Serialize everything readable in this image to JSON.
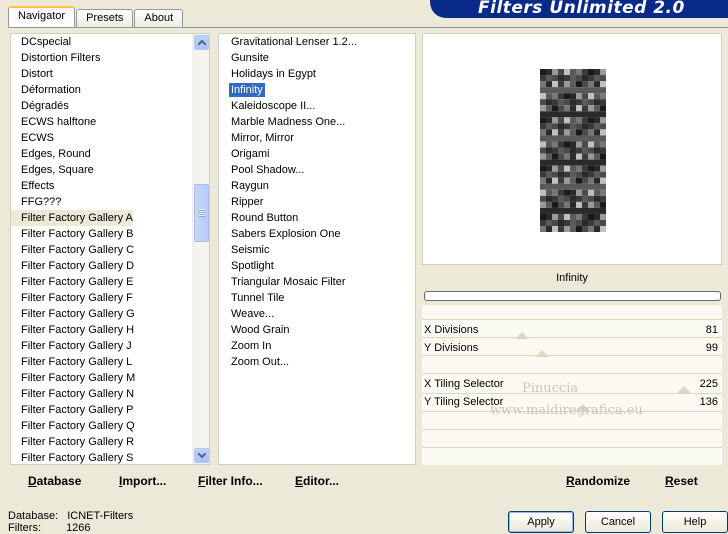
{
  "tabs": [
    "Navigator",
    "Presets",
    "About"
  ],
  "app_title": "Filters Unlimited 2.0",
  "categories": [
    "DCspecial",
    "Distortion Filters",
    "Distort",
    "Déformation",
    "Dégradés",
    "ECWS halftone",
    "ECWS",
    "Edges, Round",
    "Edges, Square",
    "Effects",
    "FFG???",
    "Filter Factory Gallery A",
    "Filter Factory Gallery B",
    "Filter Factory Gallery C",
    "Filter Factory Gallery D",
    "Filter Factory Gallery E",
    "Filter Factory Gallery F",
    "Filter Factory Gallery G",
    "Filter Factory Gallery H",
    "Filter Factory Gallery J",
    "Filter Factory Gallery L",
    "Filter Factory Gallery M",
    "Filter Factory Gallery N",
    "Filter Factory Gallery P",
    "Filter Factory Gallery Q",
    "Filter Factory Gallery R",
    "Filter Factory Gallery S"
  ],
  "selected_category": "Filter Factory Gallery A",
  "filters": [
    "Gravitational Lenser 1.2...",
    "Gunsite",
    "Holidays in Egypt",
    "Infinity",
    "Kaleidoscope II...",
    "Marble Madness One...",
    "Mirror, Mirror",
    "Origami",
    "Pool Shadow...",
    "Raygun",
    "Ripper",
    "Round Button",
    "Sabers Explosion One",
    "Seismic",
    "Spotlight",
    "Triangular Mosaic Filter",
    "Tunnel Tile",
    "Weave...",
    "Wood Grain",
    "Zoom In",
    "Zoom Out..."
  ],
  "selected_filter": "Infinity",
  "preview_filter_name": "Infinity",
  "parameters": [
    {
      "label": "X Divisions",
      "value": "81",
      "level": 0.32
    },
    {
      "label": "Y Divisions",
      "value": "99",
      "level": 0.39
    },
    {
      "label": "X Tiling Selector",
      "value": "225",
      "level": 0.88
    },
    {
      "label": "Y Tiling Selector",
      "value": "136",
      "level": 0.53
    }
  ],
  "watermark": {
    "line1": "Pinuccia",
    "line2": "www.maidiregrafica.eu"
  },
  "bottom_links": [
    "Database",
    "Import...",
    "Filter Info...",
    "Editor..."
  ],
  "right_links": [
    "Randomize",
    "Reset"
  ],
  "status": {
    "database_label": "Database:",
    "database_value": "ICNET-Filters",
    "filters_label": "Filters:",
    "filters_value": "1266"
  },
  "dialog_buttons": [
    "Apply",
    "Cancel",
    "Help"
  ]
}
